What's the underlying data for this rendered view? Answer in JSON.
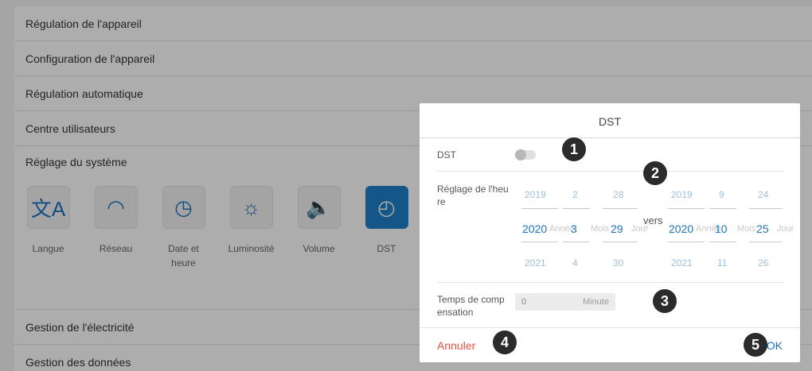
{
  "menu": {
    "rows_top": [
      "Régulation de l'appareil",
      "Configuration de l'appareil",
      "Régulation automatique",
      "Centre utilisateurs"
    ],
    "system_row": "Réglage du système",
    "rows_bottom": [
      "Gestion de l'électricité",
      "Gestion des données"
    ],
    "system_icons": [
      {
        "label": "Langue",
        "icon": "translate-icon",
        "glyph": "文A"
      },
      {
        "label": "Réseau",
        "icon": "wifi-icon",
        "glyph": "◠"
      },
      {
        "label": "Date et heure",
        "icon": "clock-icon",
        "glyph": "◷"
      },
      {
        "label": "Luminosité",
        "icon": "brightness-icon",
        "glyph": "☼"
      },
      {
        "label": "Volume",
        "icon": "volume-icon",
        "glyph": "🔈"
      },
      {
        "label": "DST",
        "icon": "dst-clock-icon",
        "glyph": "◴"
      }
    ]
  },
  "dialog": {
    "title": "DST",
    "dst_label": "DST",
    "dst_enabled": false,
    "time_label": "Réglage de l'heu re",
    "from": {
      "year": {
        "prev": "2019",
        "sel": "2020",
        "next": "2021",
        "unit": "Année"
      },
      "month": {
        "prev": "2",
        "sel": "3",
        "next": "4",
        "unit": "Mois"
      },
      "day": {
        "prev": "28",
        "sel": "29",
        "next": "30",
        "unit": "Jour"
      }
    },
    "to_word": "vers",
    "to": {
      "year": {
        "prev": "2019",
        "sel": "2020",
        "next": "2021",
        "unit": "Année"
      },
      "month": {
        "prev": "9",
        "sel": "10",
        "next": "11",
        "unit": "Mois"
      },
      "day": {
        "prev": "24",
        "sel": "25",
        "next": "26",
        "unit": "Jour"
      }
    },
    "comp_label": "Temps de comp ensation",
    "comp_value": "0",
    "comp_unit": "Minute",
    "cancel_label": "Annuler",
    "ok_label": "OK"
  },
  "badges": [
    "1",
    "2",
    "3",
    "4",
    "5"
  ],
  "colors": {
    "accent": "#1e73be",
    "cancel": "#e8533f",
    "badge": "#2b2b2b"
  }
}
